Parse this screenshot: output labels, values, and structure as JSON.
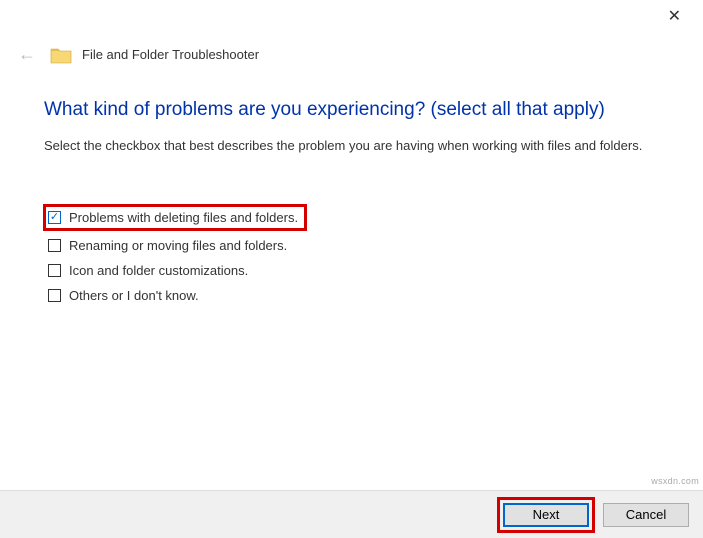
{
  "titlebar": {
    "close_glyph": "✕"
  },
  "header": {
    "back_glyph": "←",
    "title": "File and Folder Troubleshooter"
  },
  "main": {
    "heading": "What kind of problems are you experiencing? (select all that apply)",
    "instruction": "Select the checkbox that best describes the problem you are having when working with files and folders."
  },
  "options": [
    {
      "label": "Problems with deleting files and folders.",
      "checked": true,
      "highlighted": true
    },
    {
      "label": "Renaming or moving files and folders.",
      "checked": false,
      "highlighted": false
    },
    {
      "label": "Icon and folder customizations.",
      "checked": false,
      "highlighted": false
    },
    {
      "label": "Others or I don't know.",
      "checked": false,
      "highlighted": false
    }
  ],
  "footer": {
    "next_label": "Next",
    "cancel_label": "Cancel"
  },
  "watermark": "wsxdn.com"
}
